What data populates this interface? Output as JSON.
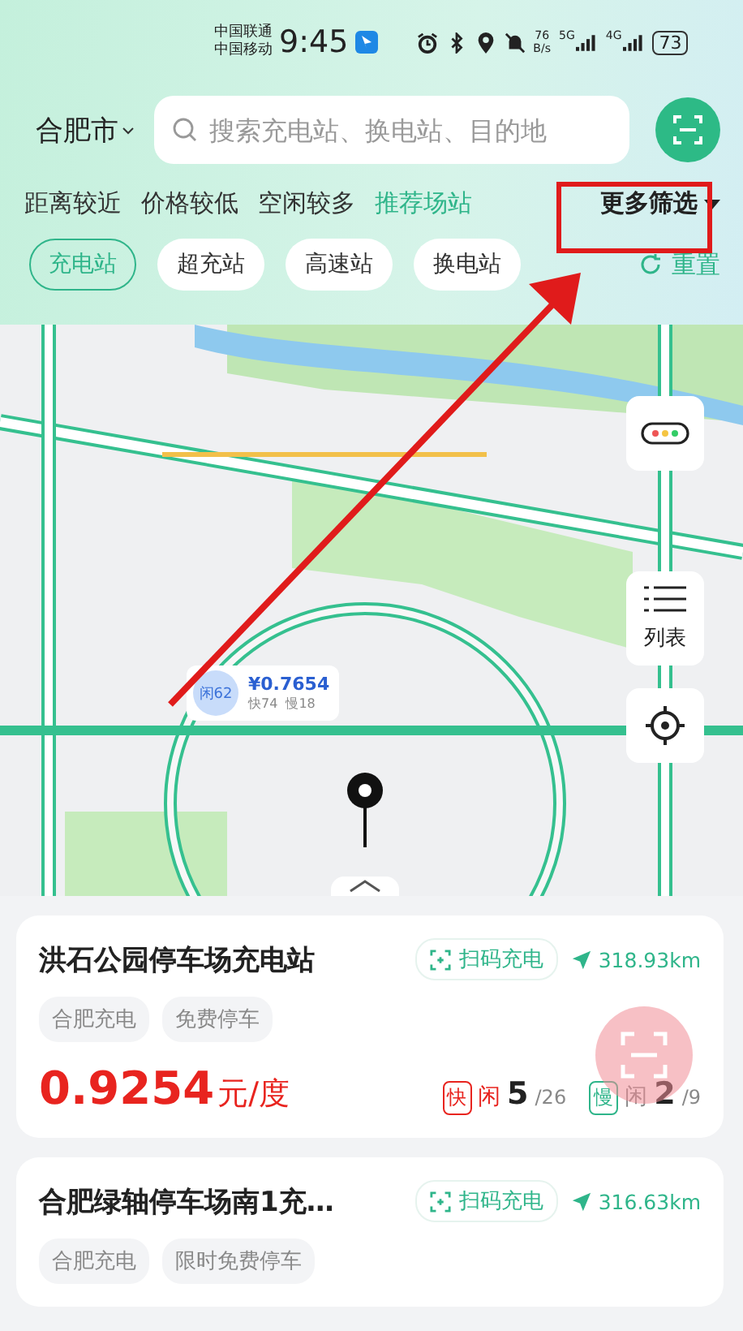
{
  "status_bar": {
    "carriers": [
      "中国联通",
      "中国移动"
    ],
    "time": "9:45",
    "speed": "76",
    "speed_unit": "B/s",
    "networks": [
      "5G",
      "4G"
    ],
    "battery": "73"
  },
  "search": {
    "city": "合肥市",
    "placeholder": "搜索充电站、换电站、目的地"
  },
  "sort_options": [
    {
      "label": "距离较近",
      "selected": false
    },
    {
      "label": "价格较低",
      "selected": false
    },
    {
      "label": "空闲较多",
      "selected": false
    },
    {
      "label": "推荐场站",
      "selected": true
    }
  ],
  "more_filters": "更多筛选",
  "chips": [
    {
      "label": "充电站",
      "selected": true
    },
    {
      "label": "超充站",
      "selected": false
    },
    {
      "label": "高速站",
      "selected": false
    },
    {
      "label": "换电站",
      "selected": false
    }
  ],
  "reset": "重置",
  "map": {
    "kind": "picture",
    "marker": {
      "idle": "闲62",
      "price": "¥0.7654",
      "fast": "快74",
      "slow": "慢18"
    },
    "list_label": "列表"
  },
  "stations": [
    {
      "name": "洪石公园停车场充电站",
      "action": "扫码充电",
      "distance": "318.93km",
      "tags": [
        "合肥充电",
        "免费停车"
      ],
      "price": "0.9254",
      "unit": "元/度",
      "counters": [
        {
          "kind": "fast",
          "badge": "快",
          "label": "闲",
          "free": "5",
          "total": "/26"
        },
        {
          "kind": "slow",
          "badge": "慢",
          "label": "闲",
          "free": "2",
          "total": "/9"
        }
      ]
    },
    {
      "name": "合肥绿轴停车场南1充…",
      "action": "扫码充电",
      "distance": "316.63km",
      "tags": [
        "合肥充电",
        "限时免费停车"
      ]
    }
  ]
}
